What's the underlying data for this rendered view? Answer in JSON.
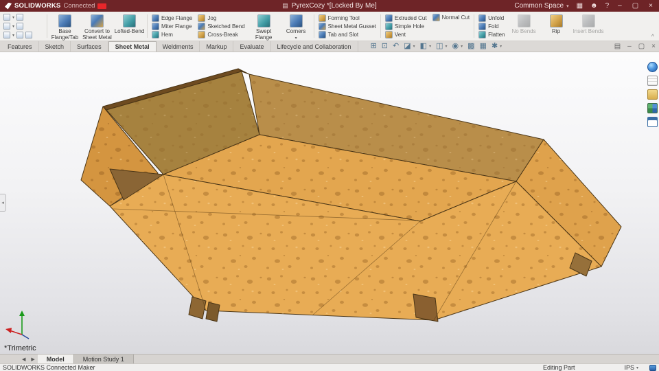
{
  "title_bar": {
    "brand": "SOLIDWORKS",
    "brand_suffix": "Connected",
    "document_title": "PyrexCozy *[Locked By Me]",
    "workspace": "Common Space"
  },
  "icons": {
    "caret_down": "▾",
    "ribbon_collapse": "^",
    "document": "▤",
    "apps_grid": "▦",
    "user": "☻",
    "help": "?",
    "minimize": "–",
    "maximize": "▢",
    "close": "×",
    "doc_cascade": "▤",
    "doc_restore": "▢",
    "doc_minimize": "–",
    "doc_close": "×",
    "nav_left": "◀",
    "nav_right": "▶",
    "pane_collapse": "◂",
    "zoom_fit": "⊞",
    "zoom_area": "⊡",
    "previous_view": "↶",
    "section_view": "◪",
    "view_orientation": "◧",
    "display_style": "◫",
    "hide_show": "◉",
    "appearance": "▩",
    "scene": "▦",
    "view_settings": "✱"
  },
  "ribbon": {
    "big_buttons": [
      "Base Flange/Tab",
      "Convert to Sheet Metal",
      "Lofted-Bend",
      "Swept Flange",
      "Corners",
      "No Bends",
      "Rip",
      "Insert Bends"
    ],
    "stack_flange": [
      "Edge Flange",
      "Miter Flange",
      "Hem"
    ],
    "stack_bend": [
      "Jog",
      "Sketched Bend",
      "Cross-Break"
    ],
    "stack_forming": [
      "Forming Tool",
      "Sheet Metal Gusset",
      "Tab and Slot"
    ],
    "stack_cut": [
      "Extruded Cut",
      "Simple Hole",
      "Vent"
    ],
    "stack_normal": [
      "Normal Cut"
    ],
    "stack_fold": [
      "Unfold",
      "Fold",
      "Flatten"
    ]
  },
  "command_tabs": {
    "items": [
      "Features",
      "Sketch",
      "Surfaces",
      "Sheet Metal",
      "Weldments",
      "Markup",
      "Evaluate",
      "Lifecycle and Collaboration"
    ],
    "active": "Sheet Metal"
  },
  "viewport": {
    "view_orientation_label": "*Trimetric"
  },
  "bottom_tabs": {
    "model": "Model",
    "motion_study": "Motion Study 1"
  },
  "status_bar": {
    "app_name": "SOLIDWORKS Connected Maker",
    "mode": "Editing Part",
    "units": "IPS"
  },
  "colors": {
    "titlebar": "#6e2427",
    "accent_red": "#e8262a",
    "sponge_light": "#e8ac55",
    "sponge_mid": "#dfa24c",
    "sponge_wall": "#b98e4a",
    "sponge_shadow": "#a6823f",
    "edge_dark": "#4a3516"
  }
}
